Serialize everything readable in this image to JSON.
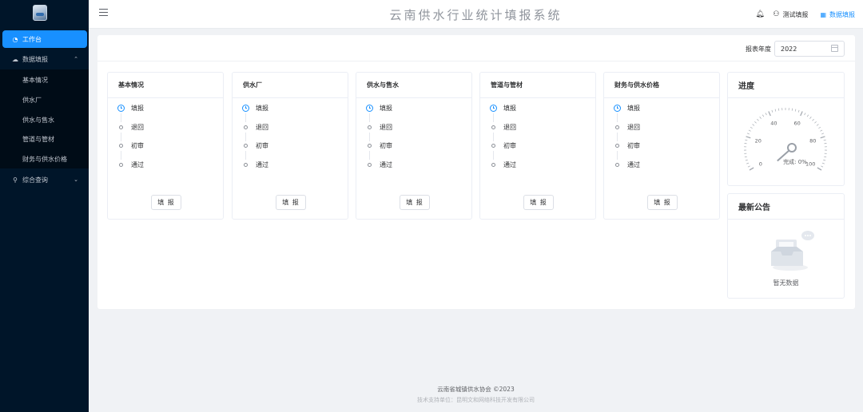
{
  "header": {
    "title": "云南供水行业统计填报系统",
    "user_label": "测试填报",
    "report_label": "数据填报"
  },
  "sidebar": {
    "items": [
      {
        "label": "工作台",
        "icon": "dashboard-icon",
        "active": true
      },
      {
        "label": "数据填报",
        "icon": "cloud-upload-icon",
        "expanded": true
      },
      {
        "label": "综合查询",
        "icon": "search-icon",
        "expanded": false
      }
    ],
    "sub_items": [
      "基本情况",
      "供水厂",
      "供水与售水",
      "管道与管材",
      "财务与供水价格"
    ]
  },
  "filter": {
    "year_label": "报表年度",
    "year_value": "2022"
  },
  "cards": [
    {
      "title": "基本情况",
      "steps": [
        "填报",
        "退回",
        "初审",
        "通过"
      ],
      "button": "填 报"
    },
    {
      "title": "供水厂",
      "steps": [
        "填报",
        "退回",
        "初审",
        "通过"
      ],
      "button": "填 报"
    },
    {
      "title": "供水与售水",
      "steps": [
        "填报",
        "退回",
        "初审",
        "通过"
      ],
      "button": "填 报"
    },
    {
      "title": "管道与管材",
      "steps": [
        "填报",
        "退回",
        "初审",
        "通过"
      ],
      "button": "填 报"
    },
    {
      "title": "财务与供水价格",
      "steps": [
        "填报",
        "退回",
        "初审",
        "通过"
      ],
      "button": "填 报"
    }
  ],
  "progress": {
    "title": "进度",
    "value": 0,
    "ticks": [
      "0",
      "20",
      "40",
      "60",
      "80",
      "100"
    ],
    "caption": "完成: 0%"
  },
  "notice": {
    "title": "最新公告",
    "empty_text": "暂无数据"
  },
  "footer": {
    "copyright": "云南省城镇供水协会 ©2023",
    "support": "技术支持单位：昆明文和网络科技开发有限公司"
  },
  "colors": {
    "sidebar_bg": "#001529",
    "accent": "#1890ff",
    "page_bg": "#f0f2f5"
  }
}
